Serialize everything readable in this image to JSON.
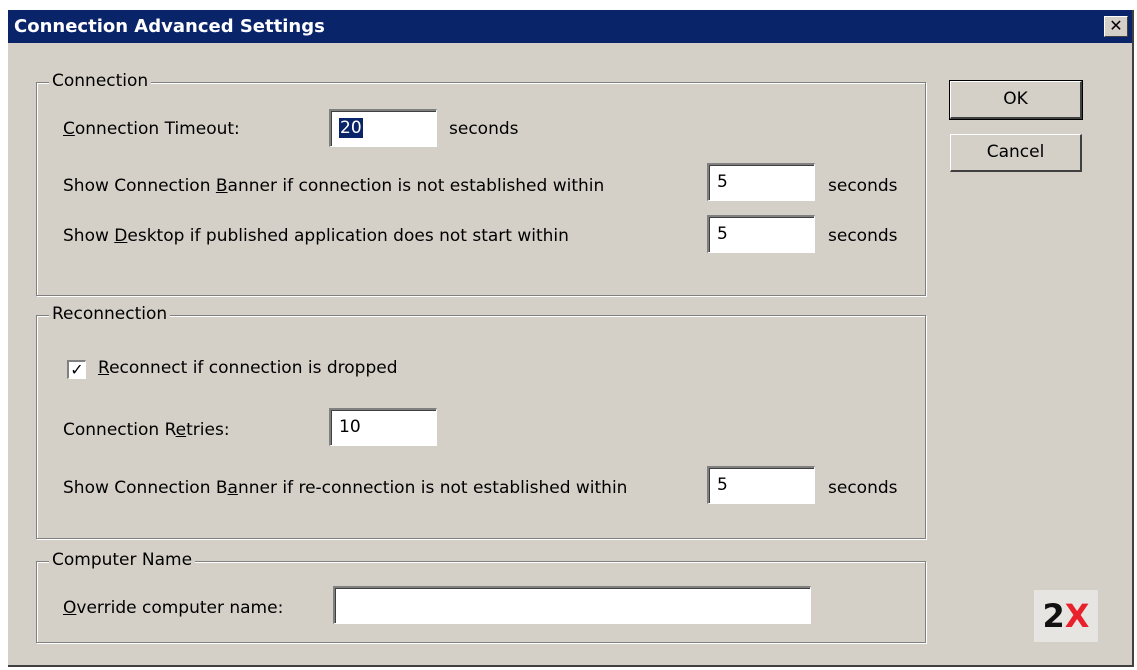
{
  "window": {
    "title": "Connection Advanced Settings",
    "close_glyph": "✕"
  },
  "buttons": {
    "ok": "OK",
    "cancel": "Cancel"
  },
  "connection_group": {
    "legend": "Connection",
    "timeout": {
      "label_pre": "",
      "label_u": "C",
      "label_post": "onnection Timeout:",
      "value": "20",
      "unit": "seconds"
    },
    "banner": {
      "label_pre": "Show Connection ",
      "label_u": "B",
      "label_post": "anner if connection is not established within",
      "value": "5",
      "unit": "seconds"
    },
    "desktop": {
      "label_pre": "Show ",
      "label_u": "D",
      "label_post": "esktop if published application does not start within",
      "value": "5",
      "unit": "seconds"
    }
  },
  "reconnection_group": {
    "legend": "Reconnection",
    "reconnect_checkbox": {
      "checked": true,
      "check_glyph": "✓",
      "label_pre": "",
      "label_u": "R",
      "label_post": "econnect if connection is dropped"
    },
    "retries": {
      "label_pre": "Connection R",
      "label_u": "e",
      "label_post": "tries:",
      "value": "10"
    },
    "banner": {
      "label_pre": "Show Connection B",
      "label_u": "a",
      "label_post": "nner if re-connection is not established within",
      "value": "5",
      "unit": "seconds"
    }
  },
  "computer_name_group": {
    "legend": "Computer Name",
    "override": {
      "label_pre": "",
      "label_u": "O",
      "label_post": "verride computer name:",
      "value": ""
    }
  },
  "logo": {
    "two": "2",
    "x": "X",
    "icon": "2x-logo-icon"
  }
}
